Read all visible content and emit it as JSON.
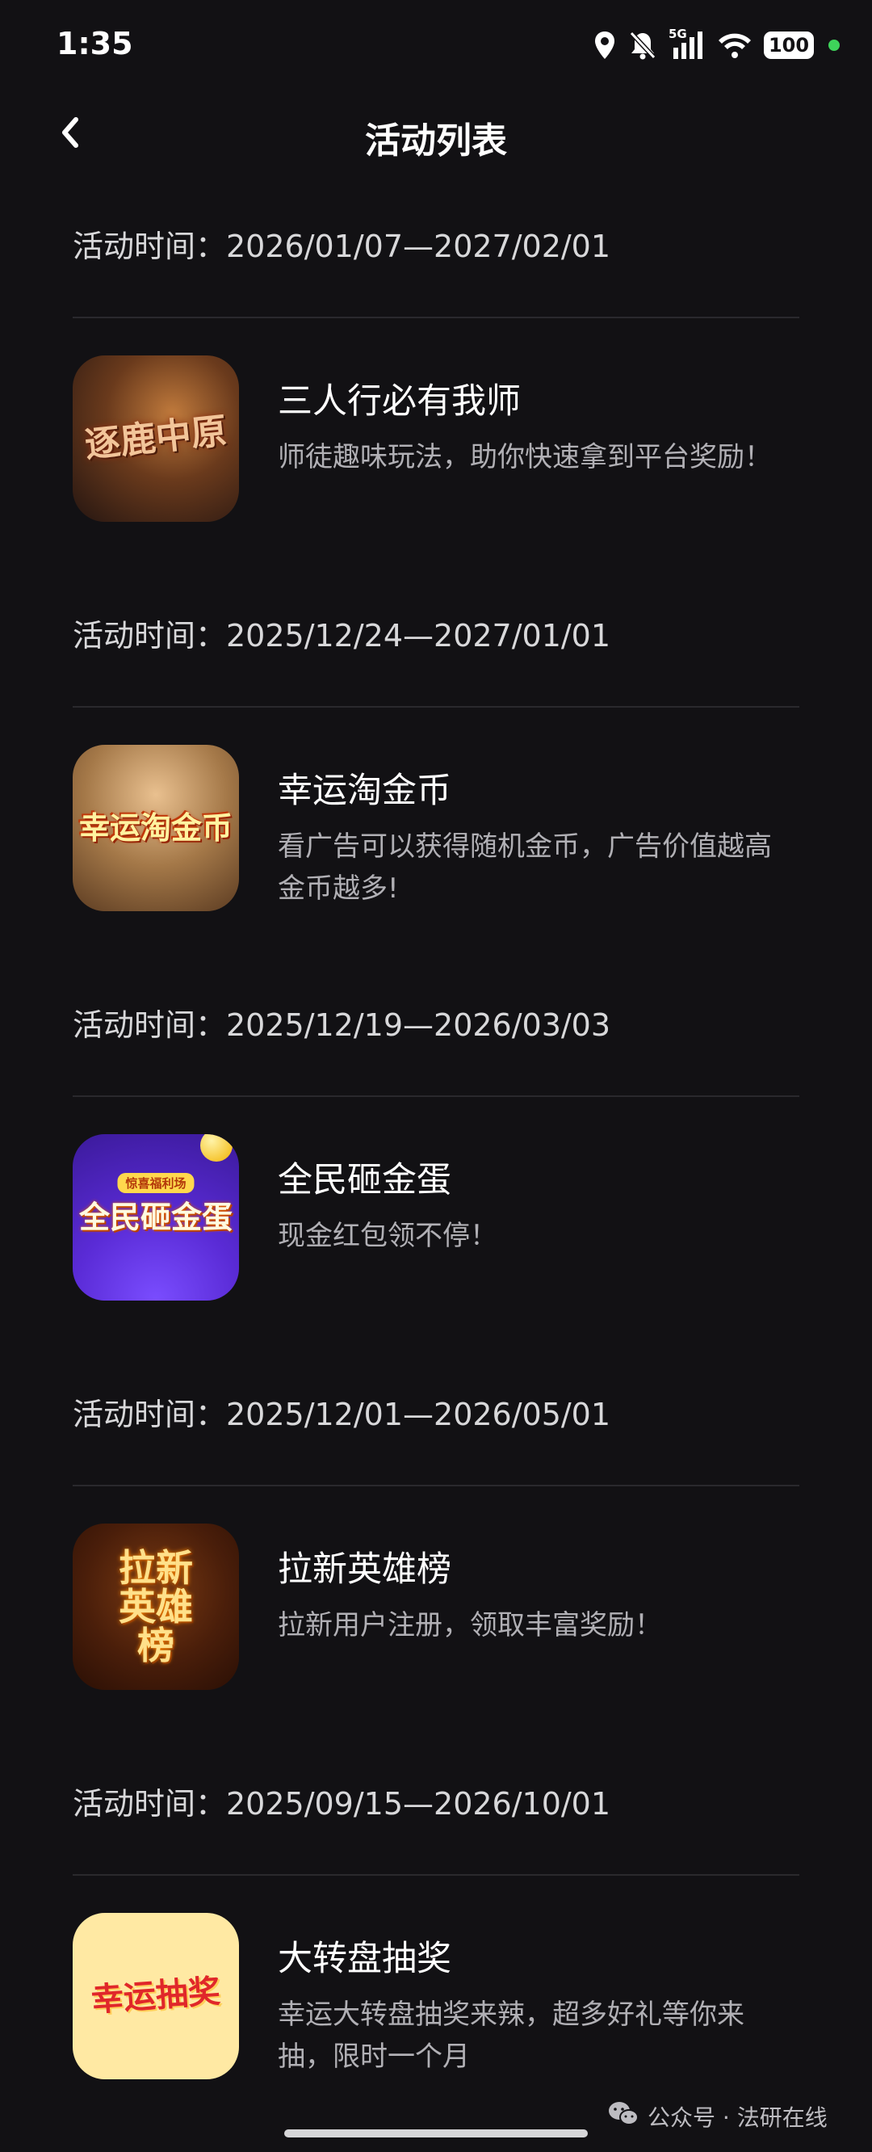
{
  "status_bar": {
    "time": "1:35",
    "battery": "100",
    "icons": [
      "location-icon",
      "bell-muted-icon",
      "signal-5g-icon",
      "wifi-icon",
      "battery-icon"
    ],
    "network_label": "5G",
    "charging_dot_color": "#3ed35a"
  },
  "nav": {
    "back_icon": "chevron-left-icon",
    "title": "活动列表"
  },
  "activities": [
    {
      "time": "活动时间：2026/01/07—2027/02/01",
      "thumb_text": "逐鹿中原",
      "title": "三人行必有我师",
      "desc": "师徒趣味玩法，助你快速拿到平台奖励！"
    },
    {
      "time": "活动时间：2025/12/24—2027/01/01",
      "thumb_text": "幸运淘金币",
      "title": "幸运淘金币",
      "desc": "看广告可以获得随机金币，广告价值越高金币越多!"
    },
    {
      "time": "活动时间：2025/12/19—2026/03/03",
      "thumb_text": "全民砸金蛋",
      "thumb_badge": "惊喜福利场",
      "title": "全民砸金蛋",
      "desc": "现金红包领不停！"
    },
    {
      "time": "活动时间：2025/12/01—2026/05/01",
      "thumb_text": "拉新英雄榜",
      "title": "拉新英雄榜",
      "desc": "拉新用户注册，领取丰富奖励！"
    },
    {
      "time": "活动时间：2025/09/15—2026/10/01",
      "thumb_text": "幸运抽奖",
      "title": "大转盘抽奖",
      "desc": "幸运大转盘抽奖来辣，超多好礼等你来抽，限时一个月"
    }
  ],
  "watermark": {
    "icon": "wechat-icon",
    "text": "公众号 · 法研在线"
  }
}
